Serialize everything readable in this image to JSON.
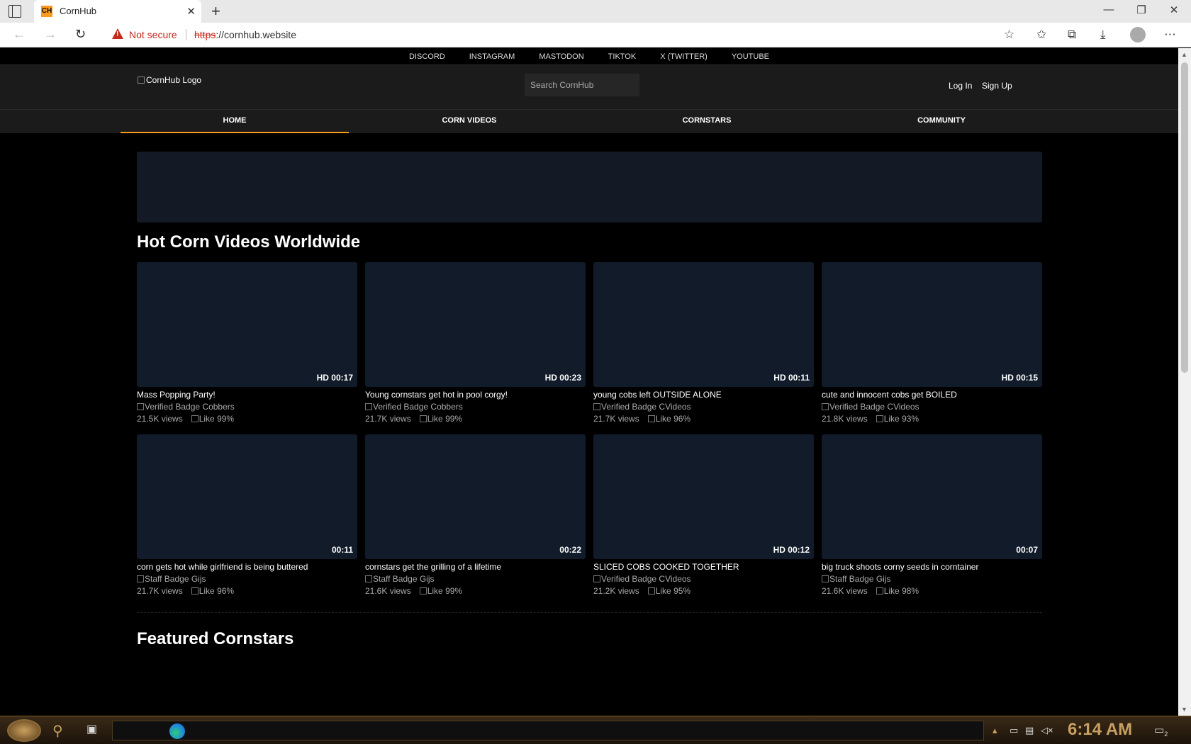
{
  "browser": {
    "tab_title": "CornHub",
    "favicon_text": "CH",
    "security_label": "Not secure",
    "url_scheme": "https",
    "url_rest": "://cornhub.website"
  },
  "site": {
    "social_links": [
      "DISCORD",
      "INSTAGRAM",
      "MASTODON",
      "TIKTOK",
      "X (TWITTER)",
      "YOUTUBE"
    ],
    "logo_alt": "CornHub Logo",
    "search_placeholder": "Search CornHub",
    "login_label": "Log In",
    "signup_label": "Sign Up",
    "nav": [
      "HOME",
      "CORN VIDEOS",
      "CORNSTARS",
      "COMMUNITY"
    ],
    "nav_active": "HOME",
    "section_hot": "Hot Corn Videos Worldwide",
    "section_featured": "Featured Cornstars",
    "videos": [
      {
        "title": "Mass Popping Party!",
        "badge": "Verified Badge",
        "channel": "Cobbers",
        "views": "21.5K views",
        "like": "Like",
        "rating": "99%",
        "duration": "HD 00:17"
      },
      {
        "title": "Young cornstars get hot in pool corgy!",
        "badge": "Verified Badge",
        "channel": "Cobbers",
        "views": "21.7K views",
        "like": "Like",
        "rating": "99%",
        "duration": "HD 00:23"
      },
      {
        "title": "young cobs left OUTSIDE ALONE",
        "badge": "Verified Badge",
        "channel": "CVideos",
        "views": "21.7K views",
        "like": "Like",
        "rating": "96%",
        "duration": "HD 00:11"
      },
      {
        "title": "cute and innocent cobs get BOILED",
        "badge": "Verified Badge",
        "channel": "CVideos",
        "views": "21.8K views",
        "like": "Like",
        "rating": "93%",
        "duration": "HD 00:15"
      },
      {
        "title": "corn gets hot while girlfriend is being buttered",
        "badge": "Staff Badge",
        "channel": "Gijs",
        "views": "21.7K views",
        "like": "Like",
        "rating": "96%",
        "duration": "00:11"
      },
      {
        "title": "cornstars get the grilling of a lifetime",
        "badge": "Staff Badge",
        "channel": "Gijs",
        "views": "21.6K views",
        "like": "Like",
        "rating": "99%",
        "duration": "00:22"
      },
      {
        "title": "SLICED COBS COOKED TOGETHER",
        "badge": "Verified Badge",
        "channel": "CVideos",
        "views": "21.2K views",
        "like": "Like",
        "rating": "95%",
        "duration": "HD 00:12"
      },
      {
        "title": "big truck shoots corny seeds in corntainer",
        "badge": "Staff Badge",
        "channel": "Gijs",
        "views": "21.6K views",
        "like": "Like",
        "rating": "98%",
        "duration": "00:07"
      }
    ]
  },
  "taskbar": {
    "clock": "6:14 AM",
    "notification_count": "2"
  },
  "colors": {
    "accent": "#f79a1e",
    "header_bg": "#1b1b1b",
    "thumb_bg": "#111b29"
  },
  "icons": [
    "tab-actions-icon",
    "close-icon",
    "plus-icon",
    "minimize-icon",
    "restore-icon",
    "back-icon",
    "forward-icon",
    "refresh-icon",
    "warning-icon",
    "favorite-add-icon",
    "favorites-icon",
    "collections-icon",
    "downloads-icon",
    "profile-icon",
    "more-icon"
  ]
}
